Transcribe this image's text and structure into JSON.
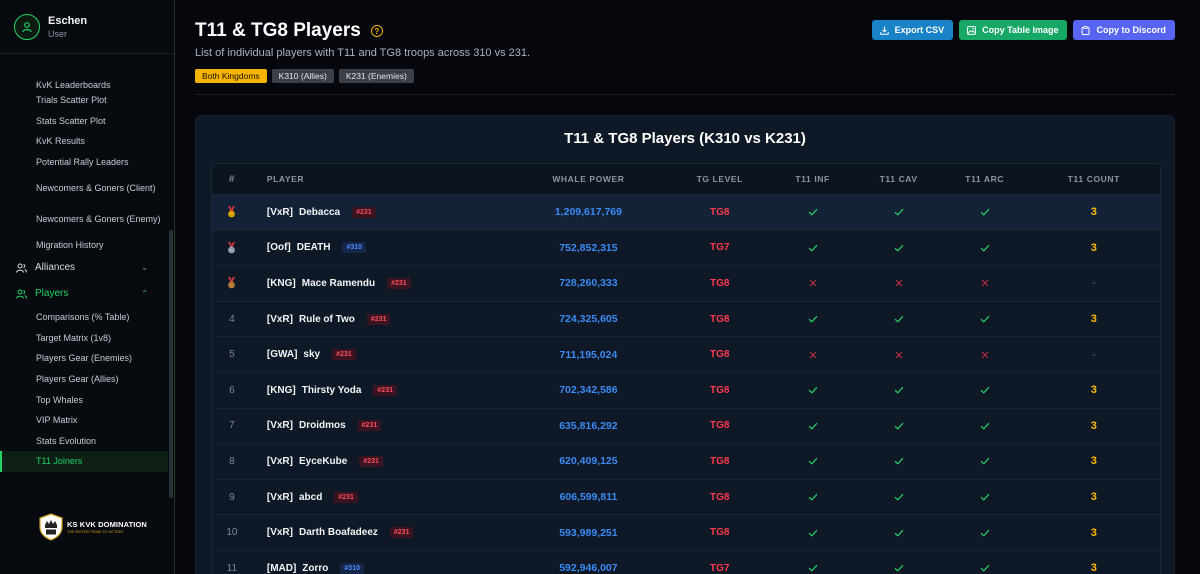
{
  "user": {
    "name": "Eschen",
    "role": "User"
  },
  "sidebar": {
    "kvk_items": [
      "KvK Leaderboards",
      "Trials Scatter Plot",
      "Stats Scatter Plot",
      "KvK Results",
      "Potential Rally Leaders",
      "Newcomers & Goners (Client)",
      "Newcomers & Goners (Enemy)",
      "Migration History"
    ],
    "alliances_label": "Alliances",
    "players_label": "Players",
    "player_items": [
      "Comparisons (% Table)",
      "Target Matrix (1v8)",
      "Players Gear (Enemies)",
      "Players Gear (Allies)",
      "Top Whales",
      "VIP Matrix",
      "Stats Evolution",
      "T11 Joiners"
    ],
    "active_item": "T11 Joiners",
    "logo_title": "KS KVK DOMINATION",
    "logo_sub": "THE FASTEST ROAD TO VICTORY"
  },
  "page": {
    "title": "T11 & TG8 Players",
    "subtitle": "List of individual players with T11 and TG8 troops across 310 vs 231.",
    "tags": [
      "Both Kingdoms",
      "K310 (Allies)",
      "K231 (Enemies)"
    ],
    "active_tag": "Both Kingdoms",
    "buttons": {
      "export": "Export CSV",
      "copy_image": "Copy Table Image",
      "copy_discord": "Copy to Discord"
    }
  },
  "colors": {
    "accent": "#25d366",
    "ally": "#4d8dff",
    "enemy": "#ff4d5e",
    "power": "#3b8bf5",
    "count": "#ffbe0b"
  },
  "table": {
    "title": "T11 & TG8 Players (K310 vs K231)",
    "headers": [
      "#",
      "PLAYER",
      "WHALE POWER",
      "TG LEVEL",
      "T11 INF",
      "T11 CAV",
      "T11 ARC",
      "T11 COUNT"
    ],
    "rows": [
      {
        "rank": "1",
        "medal": "gold",
        "alliance": "[VxR]",
        "name": "Debacca",
        "kingdom": "#231",
        "side": "enemy",
        "power": "1,209,617,769",
        "tg": "TG8",
        "inf": true,
        "cav": true,
        "arc": true,
        "count": "3"
      },
      {
        "rank": "2",
        "medal": "silver",
        "alliance": "[Oof]",
        "name": "DEATH",
        "kingdom": "#310",
        "side": "ally",
        "power": "752,852,315",
        "tg": "TG7",
        "inf": true,
        "cav": true,
        "arc": true,
        "count": "3"
      },
      {
        "rank": "3",
        "medal": "bronze",
        "alliance": "[KNG]",
        "name": "Mace Ramendu",
        "kingdom": "#231",
        "side": "enemy",
        "power": "728,260,333",
        "tg": "TG8",
        "inf": false,
        "cav": false,
        "arc": false,
        "count": "-"
      },
      {
        "rank": "4",
        "medal": "",
        "alliance": "[VxR]",
        "name": "Rule of Two",
        "kingdom": "#231",
        "side": "enemy",
        "power": "724,325,605",
        "tg": "TG8",
        "inf": true,
        "cav": true,
        "arc": true,
        "count": "3"
      },
      {
        "rank": "5",
        "medal": "",
        "alliance": "[GWA]",
        "name": "sky",
        "kingdom": "#231",
        "side": "enemy",
        "power": "711,195,024",
        "tg": "TG8",
        "inf": false,
        "cav": false,
        "arc": false,
        "count": "-"
      },
      {
        "rank": "6",
        "medal": "",
        "alliance": "[KNG]",
        "name": "Thirsty Yoda",
        "kingdom": "#231",
        "side": "enemy",
        "power": "702,342,586",
        "tg": "TG8",
        "inf": true,
        "cav": true,
        "arc": true,
        "count": "3"
      },
      {
        "rank": "7",
        "medal": "",
        "alliance": "[VxR]",
        "name": "Droidmos",
        "kingdom": "#231",
        "side": "enemy",
        "power": "635,816,292",
        "tg": "TG8",
        "inf": true,
        "cav": true,
        "arc": true,
        "count": "3"
      },
      {
        "rank": "8",
        "medal": "",
        "alliance": "[VxR]",
        "name": "EyceKube",
        "kingdom": "#231",
        "side": "enemy",
        "power": "620,409,125",
        "tg": "TG8",
        "inf": true,
        "cav": true,
        "arc": true,
        "count": "3"
      },
      {
        "rank": "9",
        "medal": "",
        "alliance": "[VxR]",
        "name": "abcd",
        "kingdom": "#231",
        "side": "enemy",
        "power": "606,599,811",
        "tg": "TG8",
        "inf": true,
        "cav": true,
        "arc": true,
        "count": "3"
      },
      {
        "rank": "10",
        "medal": "",
        "alliance": "[VxR]",
        "name": "Darth Boafadeez",
        "kingdom": "#231",
        "side": "enemy",
        "power": "593,989,251",
        "tg": "TG8",
        "inf": true,
        "cav": true,
        "arc": true,
        "count": "3"
      },
      {
        "rank": "11",
        "medal": "",
        "alliance": "[MAD]",
        "name": "Zorro",
        "kingdom": "#310",
        "side": "ally",
        "power": "592,946,007",
        "tg": "TG7",
        "inf": true,
        "cav": true,
        "arc": true,
        "count": "3"
      }
    ]
  }
}
